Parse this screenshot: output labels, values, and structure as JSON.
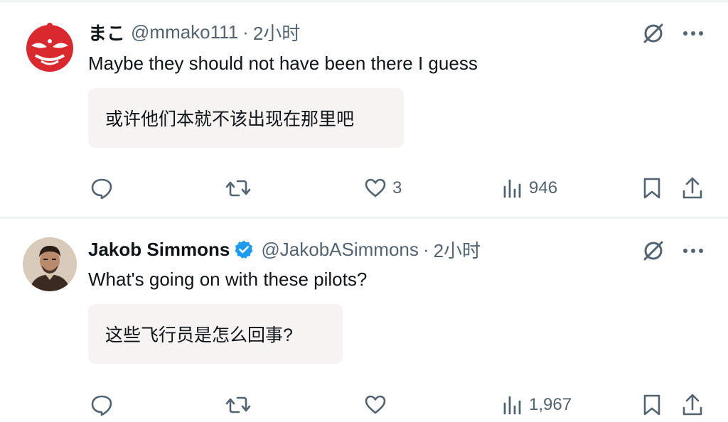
{
  "colors": {
    "text": "#0f1419",
    "secondary": "#536471",
    "translation_bg": "#f7f3f2",
    "verified_blue": "#1d9bf0",
    "divider": "#eff3f4"
  },
  "tweets": [
    {
      "display_name": "まこ",
      "handle": "@mmako111",
      "separator": "·",
      "time": "2小时",
      "verified": false,
      "text": "Maybe they should not have been there I guess",
      "translation": "或许他们本就不该出现在那里吧",
      "actions": {
        "reply_icon": "reply-icon",
        "retweet_icon": "retweet-icon",
        "like_icon": "heart-icon",
        "like_count": "3",
        "views_icon": "views-icon",
        "views_count": "946",
        "bookmark_icon": "bookmark-icon",
        "share_icon": "share-icon"
      },
      "top_icons": [
        "grok-icon",
        "more-icon"
      ]
    },
    {
      "display_name": "Jakob Simmons",
      "handle": "@JakobASimmons",
      "separator": "·",
      "time": "2小时",
      "verified": true,
      "text": "What's going on with these pilots?",
      "translation": "这些飞行员是怎么回事?",
      "actions": {
        "reply_icon": "reply-icon",
        "retweet_icon": "retweet-icon",
        "like_icon": "heart-icon",
        "like_count": "",
        "views_icon": "views-icon",
        "views_count": "1,967",
        "bookmark_icon": "bookmark-icon",
        "share_icon": "share-icon"
      },
      "top_icons": [
        "grok-icon",
        "more-icon"
      ]
    }
  ]
}
